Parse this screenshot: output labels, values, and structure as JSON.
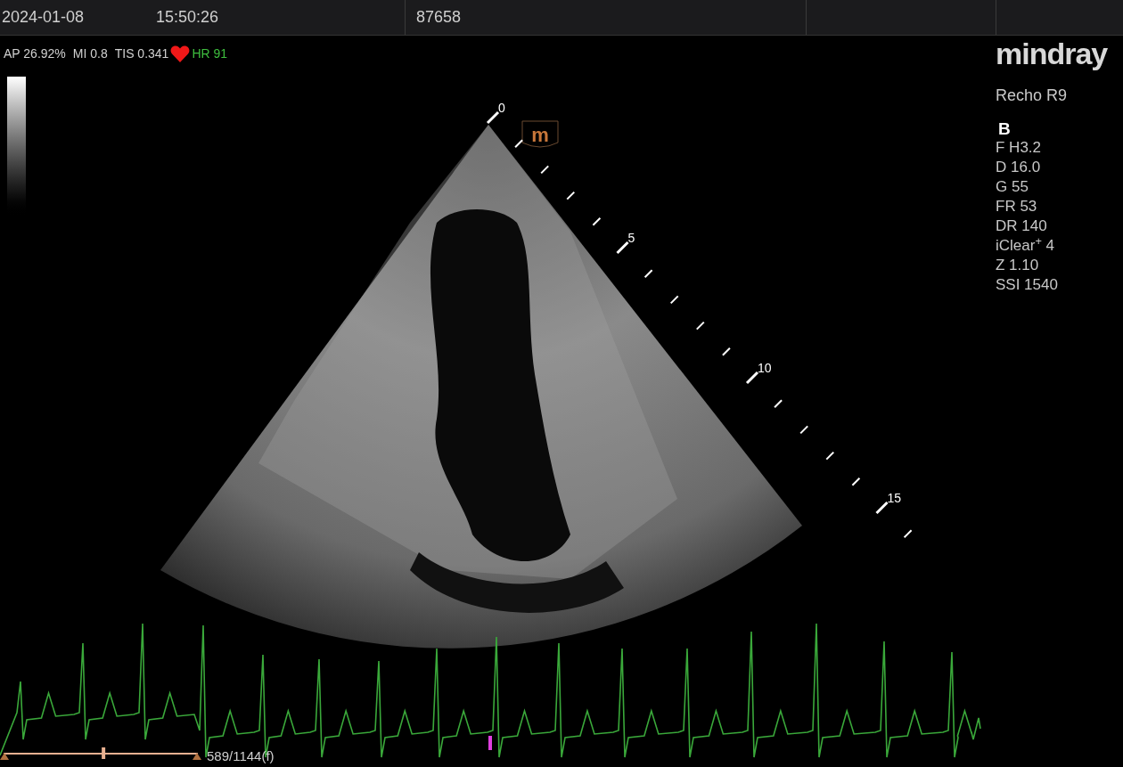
{
  "header": {
    "date": "2024-01-08",
    "time": "15:50:26",
    "patient_id": "87658"
  },
  "acoustic_output": [
    "AP 26.92%",
    "MI 0.8",
    "TIS 0.341"
  ],
  "heart_rate": "HR 91",
  "logo": "mindray",
  "probe": "Recho R9",
  "mode": "B",
  "parameters": [
    "F H3.2",
    "D 16.0",
    "G 55",
    "FR 53",
    "DR 140",
    "iClear$^{+}$ 4",
    "Z 1.10",
    "SSI 1540"
  ],
  "orientation_marker": "m",
  "depth_labels": [
    "0",
    "5",
    "10",
    "15"
  ],
  "cine": {
    "level": 0.51,
    "frame": "589/1144(f)"
  }
}
